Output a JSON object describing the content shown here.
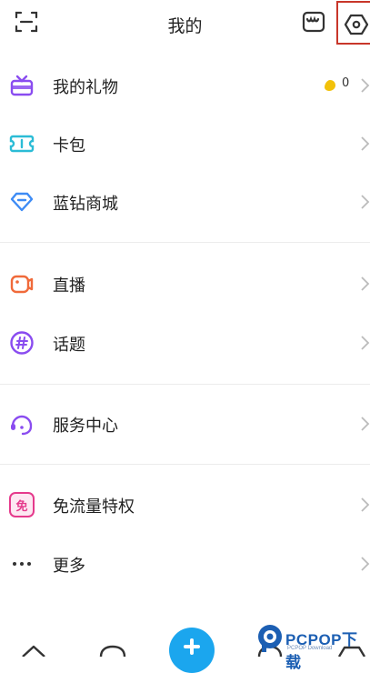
{
  "header": {
    "title": "我的",
    "left_icon": "scan-icon",
    "right_icons": [
      "store-icon",
      "settings-icon"
    ]
  },
  "menu": {
    "gift": {
      "label": "我的礼物",
      "icon": "gift-icon",
      "coin_count": "0"
    },
    "wallet": {
      "label": "卡包",
      "icon": "card-wallet-icon"
    },
    "diamond_store": {
      "label": "蓝钻商城",
      "icon": "diamond-icon"
    },
    "live": {
      "label": "直播",
      "icon": "live-camera-icon"
    },
    "topics": {
      "label": "话题",
      "icon": "hashtag-icon"
    },
    "service": {
      "label": "服务中心",
      "icon": "headset-icon"
    },
    "free_data": {
      "label": "免流量特权",
      "icon": "free-data-icon",
      "icon_glyph": "免"
    },
    "more": {
      "label": "更多",
      "icon": "more-dots-icon"
    }
  },
  "watermark": {
    "brand": "PCPOP下载",
    "sub": "PCPOP Download"
  },
  "colors": {
    "purple": "#8a4cf0",
    "teal": "#2bbcd6",
    "blue": "#3d8bf5",
    "orange": "#f06a3a",
    "pink": "#e53a8c",
    "fab": "#1ba6ee",
    "highlight": "#c8362a"
  }
}
